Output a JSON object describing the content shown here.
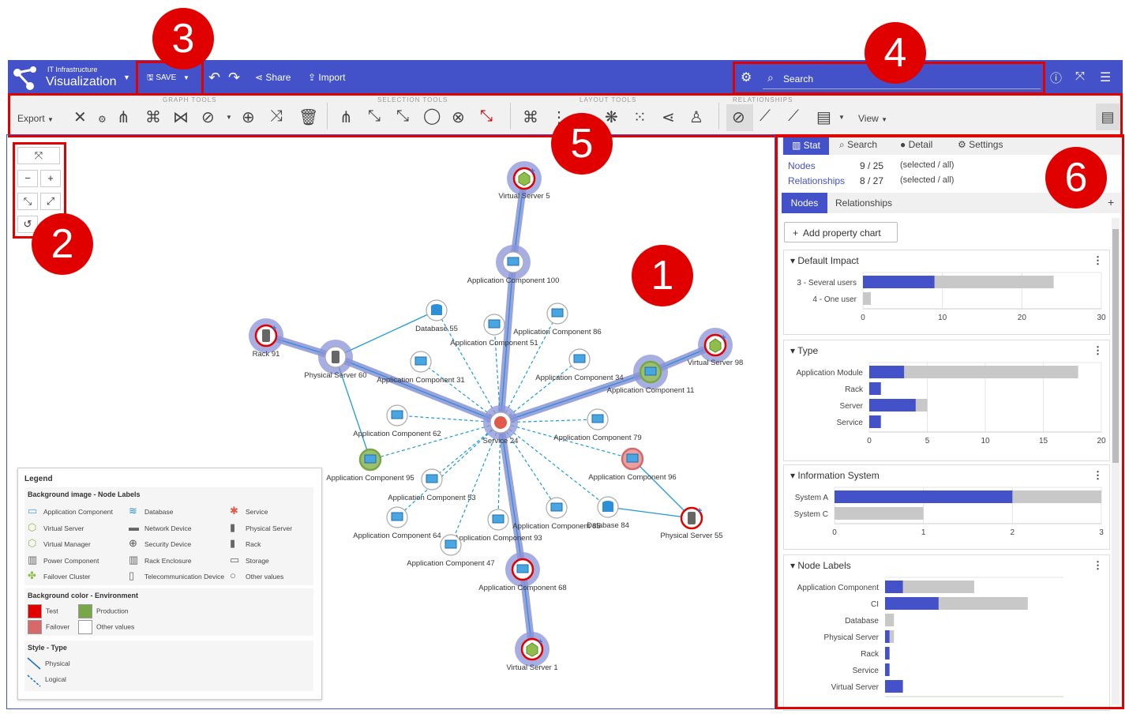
{
  "app": {
    "subtitle": "IT Infrastructure",
    "title": "Visualization"
  },
  "topbar": {
    "save_label": "SAVE",
    "share_label": "Share",
    "import_label": "Import",
    "search_placeholder": "Search"
  },
  "toolbar": {
    "export_label": "Export",
    "groups": [
      "GRAPH TOOLS",
      "SELECTION TOOLS",
      "LAYOUT TOOLS",
      "RELATIONSHIPS"
    ],
    "view_label": "View"
  },
  "badges": [
    "1",
    "2",
    "3",
    "4",
    "5",
    "6"
  ],
  "graph": {
    "nodes": [
      {
        "label": "Virtual Server 5",
        "type": "virtual-server"
      },
      {
        "label": "Application Component 100",
        "type": "app"
      },
      {
        "label": "Database 55",
        "type": "database"
      },
      {
        "label": "Application Component 51",
        "type": "app"
      },
      {
        "label": "Application Component 86",
        "type": "app"
      },
      {
        "label": "Rack 91",
        "type": "rack"
      },
      {
        "label": "Physical Server 60",
        "type": "physical-server"
      },
      {
        "label": "Application Component 31",
        "type": "app"
      },
      {
        "label": "Application Component 34",
        "type": "app"
      },
      {
        "label": "Virtual Server 98",
        "type": "virtual-server"
      },
      {
        "label": "Application Component 11",
        "type": "app"
      },
      {
        "label": "Application Component 62",
        "type": "app"
      },
      {
        "label": "Service 24",
        "type": "service"
      },
      {
        "label": "Application Component 79",
        "type": "app"
      },
      {
        "label": "Application Component 95",
        "type": "app"
      },
      {
        "label": "Application Component 96",
        "type": "app"
      },
      {
        "label": "Application Component 53",
        "type": "app"
      },
      {
        "label": "Application Component 64",
        "type": "app"
      },
      {
        "label": "Application Component 93",
        "type": "app"
      },
      {
        "label": "Application Component 85",
        "type": "app"
      },
      {
        "label": "Database 84",
        "type": "database"
      },
      {
        "label": "Physical Server 55",
        "type": "physical-server"
      },
      {
        "label": "Application Component 47",
        "type": "app"
      },
      {
        "label": "Application Component 68",
        "type": "app"
      },
      {
        "label": "Virtual Server 1",
        "type": "virtual-server"
      }
    ]
  },
  "legend": {
    "title": "Legend",
    "bg_image_title": "Background image - Node Labels",
    "bg_image_items": [
      "Application Component",
      "Database",
      "Service",
      "Virtual Server",
      "Network Device",
      "Physical Server",
      "Virtual Manager",
      "Security Device",
      "Rack",
      "Power Component",
      "Rack Enclosure",
      "Storage",
      "Failover Cluster",
      "Telecommunication Device",
      "Other values"
    ],
    "bg_color_title": "Background color - Environment",
    "bg_color_items": [
      {
        "label": "Test",
        "color": "#e00000"
      },
      {
        "label": "Production",
        "color": "#7aa64a"
      },
      {
        "label": "Failover",
        "color": "#d66a6a"
      },
      {
        "label": "Other values",
        "color": "#ffffff"
      }
    ],
    "style_title": "Style - Type",
    "style_items": [
      "Physical",
      "Logical"
    ]
  },
  "panel": {
    "tabs": [
      "Stat",
      "Search",
      "Detail",
      "Settings"
    ],
    "nodes_label": "Nodes",
    "nodes_count": "9 / 25",
    "relationships_label": "Relationships",
    "relationships_count": "8 / 27",
    "sel_all": "(selected / all)",
    "subtabs": [
      "Nodes",
      "Relationships"
    ],
    "add_chart": "Add property chart"
  },
  "colors": {
    "accent": "#4352c8",
    "selected_bar": "#4352c8",
    "all_bar": "#c8c8c8",
    "annotation": "#e00000"
  },
  "chart_data": [
    {
      "type": "bar",
      "title": "Default Impact",
      "categories": [
        "3 - Several users",
        "4 - One user"
      ],
      "series": [
        {
          "name": "selected",
          "values": [
            9,
            0
          ]
        },
        {
          "name": "all",
          "values": [
            24,
            1
          ]
        }
      ],
      "xlim": [
        0,
        30
      ],
      "ticks": [
        0,
        10,
        20,
        30
      ]
    },
    {
      "type": "bar",
      "title": "Type",
      "categories": [
        "Application Module",
        "Rack",
        "Server",
        "Service"
      ],
      "series": [
        {
          "name": "selected",
          "values": [
            3,
            1,
            4,
            1
          ]
        },
        {
          "name": "all",
          "values": [
            18,
            1,
            5,
            1
          ]
        }
      ],
      "xlim": [
        0,
        20
      ],
      "ticks": [
        0,
        5,
        10,
        15,
        20
      ]
    },
    {
      "type": "bar",
      "title": "Information System",
      "categories": [
        "System A",
        "System C"
      ],
      "series": [
        {
          "name": "selected",
          "values": [
            2,
            0
          ]
        },
        {
          "name": "all",
          "values": [
            3,
            1
          ]
        }
      ],
      "xlim": [
        0,
        3
      ],
      "ticks": [
        0,
        1,
        2,
        3
      ]
    },
    {
      "type": "bar",
      "title": "Node Labels",
      "categories": [
        "Application Component",
        "CI",
        "Database",
        "Physical Server",
        "Rack",
        "Service",
        "Virtual Server"
      ],
      "series": [
        {
          "name": "selected",
          "values": [
            2,
            6,
            0,
            0.5,
            0.5,
            0.5,
            2
          ]
        },
        {
          "name": "all",
          "values": [
            10,
            16,
            1,
            1,
            0.5,
            0.5,
            2
          ]
        }
      ],
      "xlim": [
        0,
        20
      ],
      "ticks": []
    }
  ]
}
